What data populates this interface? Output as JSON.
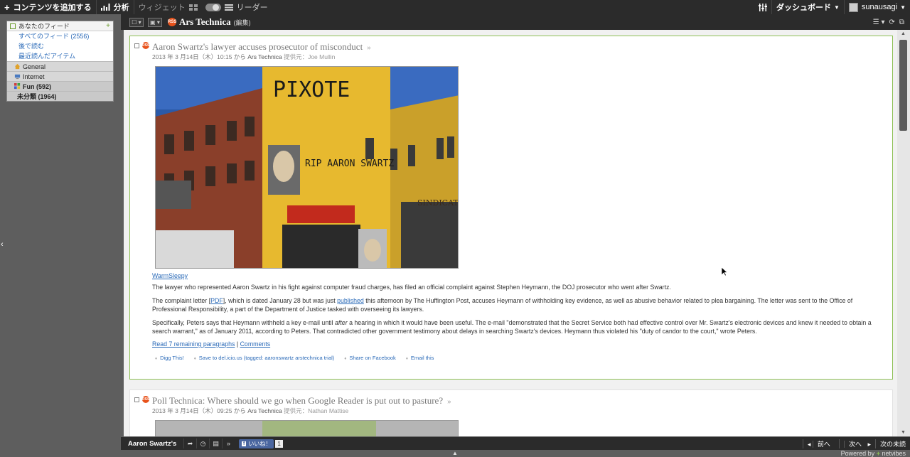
{
  "topbar": {
    "add_content": "コンテンツを追加する",
    "analytics": "分析",
    "widget": "ウィジェット",
    "reader": "リーダー",
    "dashboard": "ダッシュボード",
    "username": "sunausagi"
  },
  "sidebar": {
    "header": "あなたのフィード",
    "links": [
      "すべてのフィード (2556)",
      "後で読む",
      "最近読んだアイテム"
    ],
    "categories": [
      {
        "label": "General",
        "icon": "house-icon"
      },
      {
        "label": "Internet",
        "icon": "monitor-icon"
      },
      {
        "label": "Fun (592)",
        "icon": "grid-icon"
      },
      {
        "label": "未分類 (1964)",
        "icon": ""
      }
    ]
  },
  "reader": {
    "feed_title": "Ars Technica",
    "edit_label": "(編集)"
  },
  "articles": [
    {
      "title": "Aaron Swartz's lawyer accuses prosecutor of misconduct",
      "date": "2013 年 3 月14日（木）10:15 から",
      "source": "Ars Technica",
      "author": "提供元：Joe Mullin",
      "photo_caption_link": "WarmSleepy",
      "photo_sign": "PIXOTE",
      "photo_graffiti": "RIP AARON SWARTZ",
      "photo_store": "SINDICATO",
      "p1": "The lawyer who represented Aaron Swartz in his fight against computer fraud charges, has filed an official complaint against Stephen Heymann, the DOJ prosecutor who went after Swartz.",
      "p2a": "The complaint letter [",
      "p2pdf": "PDF",
      "p2b": "], which is dated January 28 but was just ",
      "p2pub": "published",
      "p2c": " this afternoon by The Huffington Post, accuses Heymann of withholding key evidence, as well as abusive behavior related to plea bargaining. The letter was sent to the Office of Professional Responsibility, a part of the Department of Justice tasked with overseeing its lawyers.",
      "p3a": "Specifically, Peters says that Heymann withheld a key e-mail until ",
      "p3em": "after",
      "p3b": " a hearing in which it would have been useful. The e-mail \"demonstrated that the Secret Service both had effective control over Mr. Swartz's electronic devices and knew it needed to obtain a search warrant,\" as of January 2011, according to Peters. That contradicted other government testimony about delays in searching Swartz's devices. Heymann thus violated his \"duty of candor to the court,\" wrote Peters.",
      "read_more": "Read 7 remaining paragraphs",
      "sep": " | ",
      "comments": "Comments",
      "share": [
        "Digg This!",
        "Save to del.icio.us (tagged: aaronswartz arstechnica trial)",
        "Share on Facebook",
        "Email this"
      ]
    },
    {
      "title": "Poll Technica: Where should we go when Google Reader is put out to pasture?",
      "date": "2013 年 3 月14日（木）09:25 から",
      "source": "Ars Technica",
      "author": "提供元：Nathan Mattise"
    }
  ],
  "bottombar": {
    "title": "Aaron Swartz's",
    "like": "いいね！",
    "like_f": "f",
    "like_count": "1",
    "prev": "前へ",
    "next": "次へ",
    "next_unread": "次の未読"
  },
  "footer": {
    "powered": "Powered by",
    "brand": "netvibes"
  },
  "colors": {
    "accent_green": "#8dc054",
    "link_blue": "#2a6ab8",
    "feed_orange": "#e8521b",
    "bar_dark": "#2b2b2b"
  }
}
